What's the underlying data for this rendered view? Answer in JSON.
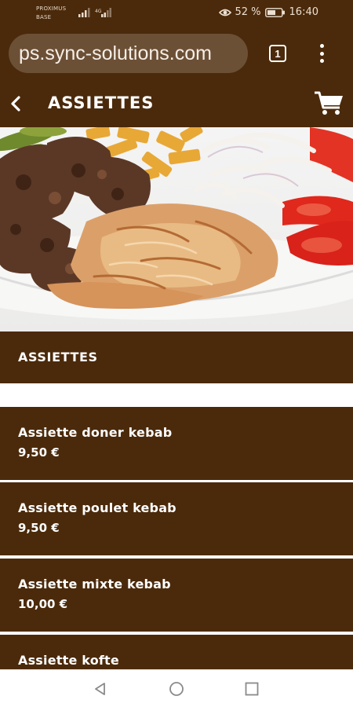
{
  "status_bar": {
    "carrier_line1": "PROXIMUS",
    "carrier_line2": "BASE",
    "network": "4G",
    "battery_percent": "52 %",
    "time": "16:40"
  },
  "browser": {
    "url": "ps.sync-solutions.com",
    "tab_count": "1"
  },
  "header": {
    "title": "ASSIETTES"
  },
  "category": {
    "title": "ASSIETTES"
  },
  "products": [
    {
      "name": "Assiette doner kebab",
      "price": "9,50 €"
    },
    {
      "name": "Assiette poulet kebab",
      "price": "9,50 €"
    },
    {
      "name": "Assiette mixte kebab",
      "price": "10,00 €"
    },
    {
      "name": "Assiette kofte",
      "price": ""
    }
  ],
  "colors": {
    "brand_brown": "#4b2a0b",
    "url_pill": "#6c5036"
  },
  "icons": [
    "back-arrow-icon",
    "cart-icon",
    "eye-icon",
    "battery-icon",
    "signal-icon",
    "kebab-menu-icon",
    "nav-back-icon",
    "nav-home-icon",
    "nav-recents-icon"
  ]
}
